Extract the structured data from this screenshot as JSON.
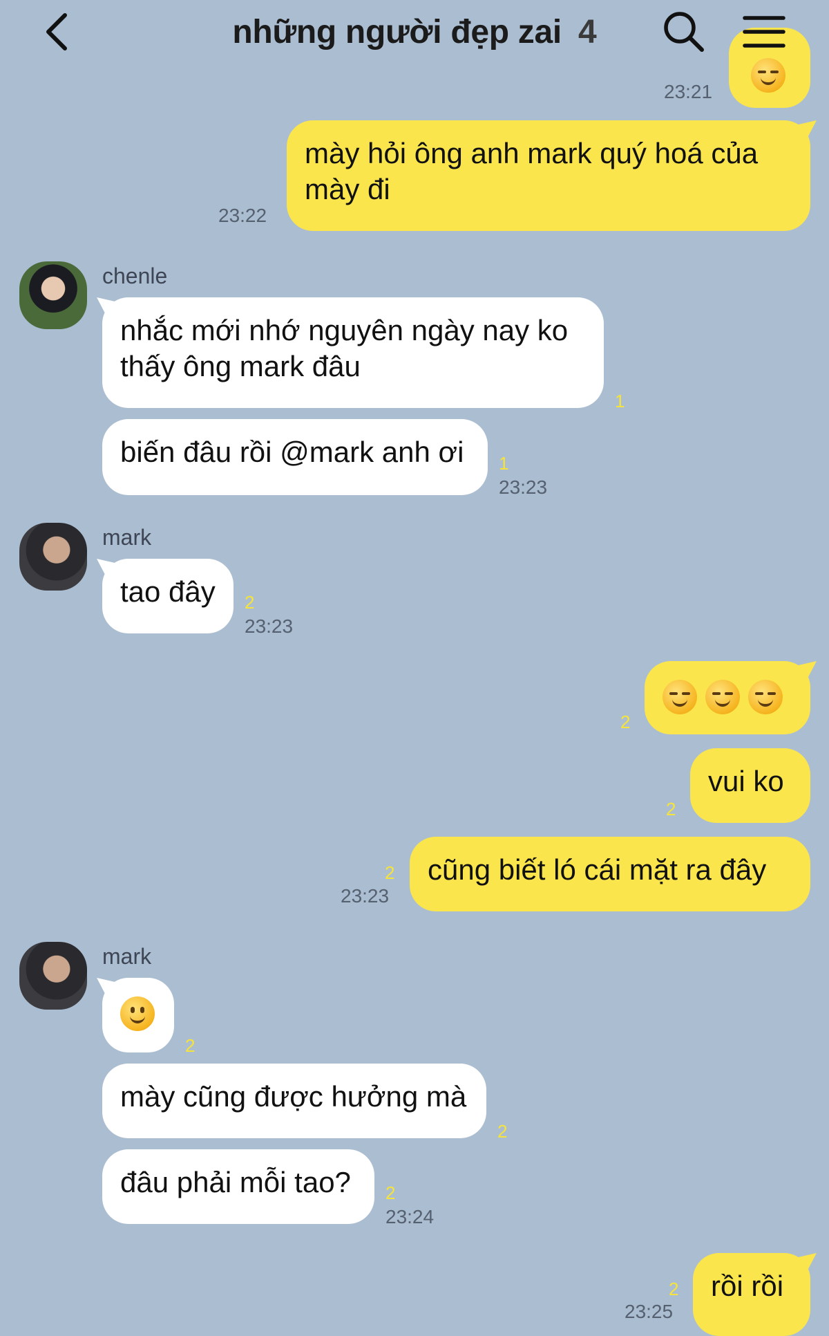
{
  "header": {
    "title": "những người đẹp zai",
    "member_count": "4",
    "icons": [
      "back-chevron-icon",
      "search-icon",
      "hamburger-menu-icon"
    ]
  },
  "messages": {
    "m0": {
      "unread": null,
      "time": "23:21"
    },
    "m1": {
      "text": "mày hỏi ông anh mark quý hoá của mày đi",
      "time": "23:22"
    },
    "m2": {
      "sender": "chenle",
      "text": "nhắc mới nhớ nguyên ngày nay ko thấy ông mark đâu",
      "unread": "1"
    },
    "m3": {
      "text": "biến đâu rồi @mark anh ơi",
      "unread": "1",
      "time": "23:23"
    },
    "m4": {
      "sender": "mark",
      "text": "tao đây",
      "unread": "2",
      "time": "23:23"
    },
    "m5": {
      "emoji": "smirking-face x3",
      "unread": "2"
    },
    "m6": {
      "text": "vui ko",
      "unread": "2"
    },
    "m7": {
      "text": "cũng biết ló cái mặt ra đây",
      "unread": "2",
      "time": "23:23"
    },
    "m8": {
      "sender": "mark",
      "emoji": "slightly-smiling-face",
      "unread": "2"
    },
    "m9": {
      "text": "mày cũng được hưởng mà",
      "unread": "2"
    },
    "m10": {
      "text": "đâu phải mỗi tao?",
      "unread": "2",
      "time": "23:24"
    },
    "m11": {
      "text": "rồi rồi",
      "unread": "2",
      "time": "23:25"
    }
  },
  "colors": {
    "background": "#abbdd1",
    "outgoing_bubble": "#fae54d",
    "incoming_bubble": "#ffffff",
    "unread_count": "#f6e43b"
  }
}
